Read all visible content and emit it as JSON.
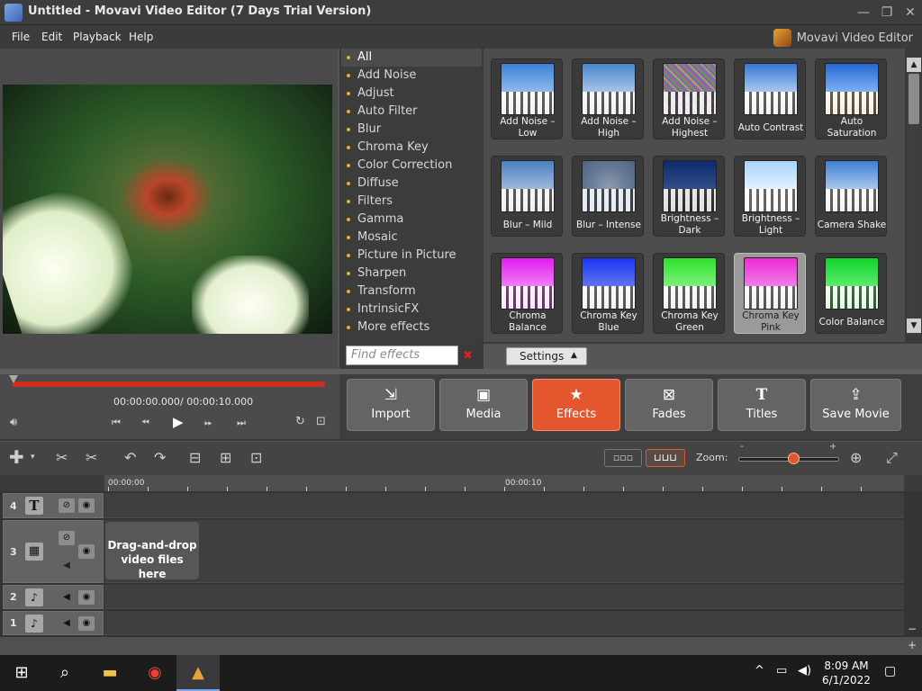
{
  "window": {
    "title": "Untitled - Movavi Video Editor (7 Days Trial Version)",
    "app_icon": "movavi-icon",
    "minimize_glyph": "—",
    "restore_glyph": "❐",
    "close_glyph": "✕",
    "brand": "Movavi Video Editor"
  },
  "menu": [
    "File",
    "Edit",
    "Playback",
    "Help"
  ],
  "effects": {
    "categories": [
      "All",
      "Add Noise",
      "Adjust",
      "Auto Filter",
      "Blur",
      "Chroma Key",
      "Color Correction",
      "Diffuse",
      "Filters",
      "Gamma",
      "Mosaic",
      "Picture in Picture",
      "Sharpen",
      "Transform",
      "IntrinsicFX",
      "More effects"
    ],
    "selected_category": "All",
    "search_placeholder": "Find effects",
    "tiles": [
      {
        "label": "Add Noise – Low",
        "bg": "linear-gradient(180deg,#3e82d6 0%,#8fb8ea 55%,#e9e9e9 56%,#bcbcbc 100%)"
      },
      {
        "label": "Add Noise – High",
        "bg": "linear-gradient(180deg,#4a86cf 0%,#a6c2e6 55%,#dcdcdc 56%,#a8a8a8 100%)"
      },
      {
        "label": "Add Noise – Highest",
        "bg": "repeating-linear-gradient(45deg,#8a5fb0 0 2px,#4fa35a 2px 4px,#c24f9a 4px 6px,#5d77c9 6px 8px,#b8a24a 8px 10px)"
      },
      {
        "label": "Auto Contrast",
        "bg": "linear-gradient(180deg,#3576d1 0%,#a9c8ef 55%,#f3f3f3 56%,#b9b9b9 100%)"
      },
      {
        "label": "Auto Saturation",
        "bg": "linear-gradient(180deg,#2668d4 0%,#7eb0f1 55%,#f2e2a8 56%,#c39a5a 100%)"
      },
      {
        "label": "Blur – Mild",
        "bg": "linear-gradient(180deg,#4a7fc0 0%,#9fb9d9 55%,#cfcfcf 56%,#9d9d9d 100%)"
      },
      {
        "label": "Blur – Intense",
        "bg": "radial-gradient(ellipse at 50% 50%,#8d9aad 0,#687b96 50%,#4d6482 100%)"
      },
      {
        "label": "Brightness – Dark",
        "bg": "linear-gradient(180deg,#0d2a6b 0%,#2f4f87 55%,#6a6a6a 56%,#2b2b2b 100%)"
      },
      {
        "label": "Brightness – Light",
        "bg": "linear-gradient(180deg,#a8d3ff 0%,#e4f1ff 55%,#ffffff 56%,#e8e8e8 100%)"
      },
      {
        "label": "Camera Shake",
        "bg": "linear-gradient(180deg,#3f7ed6 0%,#a8c7ec 55%,#f0f0f0 56%,#bdbdbd 100%)"
      },
      {
        "label": "Chroma Balance",
        "bg": "linear-gradient(180deg,#e21df0 0%,#f07cf5 55%,#f5a9f7 56%,#d55fe0 100%)"
      },
      {
        "label": "Chroma Key Blue",
        "bg": "linear-gradient(180deg,#1d35f0 0%,#5d74f3 55%,#e9e9e9 56%,#b9b9b9 100%)"
      },
      {
        "label": "Chroma Key Green",
        "bg": "linear-gradient(180deg,#2fe02c 0%,#7df07a 55%,#e9e9e9 56%,#b9b9b9 100%)"
      },
      {
        "label": "Chroma Key Pink",
        "bg": "linear-gradient(180deg,#ea2ad6 0%,#f27de6 55%,#eeeeee 56%,#bdbdbd 100%)"
      },
      {
        "label": "Color Balance",
        "bg": "linear-gradient(180deg,#0fd42a 0%,#5cea6d 55%,#a6f6ad 56%,#36c24a 100%)"
      }
    ],
    "selected_tile": "Chroma Key Pink",
    "settings_label": "Settings"
  },
  "player": {
    "current_time": "00:00:00.000",
    "total_time": "/ 00:00:10.000"
  },
  "nav": [
    {
      "label": "Import",
      "icon": "import-icon",
      "glyph": "⇲"
    },
    {
      "label": "Media",
      "icon": "media-icon",
      "glyph": "▣"
    },
    {
      "label": "Effects",
      "icon": "effects-icon",
      "glyph": "★"
    },
    {
      "label": "Fades",
      "icon": "fades-icon",
      "glyph": "⊠"
    },
    {
      "label": "Titles",
      "icon": "titles-icon",
      "glyph": "T"
    },
    {
      "label": "Save Movie",
      "icon": "save-movie-icon",
      "glyph": "⇪"
    }
  ],
  "nav_selected": "Effects",
  "timeline": {
    "zoom_label": "Zoom:",
    "zoom_minus": "-",
    "zoom_plus": "+",
    "zoom_level": 0.55,
    "ruler": [
      "00:00:00",
      "00:00:10"
    ],
    "tracks": [
      {
        "number": "4",
        "type": "title"
      },
      {
        "number": "3",
        "type": "video"
      },
      {
        "number": "2",
        "type": "audio"
      },
      {
        "number": "1",
        "type": "audio"
      }
    ],
    "drop_hint": "Drag-and-drop video files here"
  },
  "taskbar": {
    "time": "8:09 AM",
    "date": "6/1/2022"
  },
  "colors": {
    "accent": "#e4572e",
    "progress": "#cc2f1d",
    "category_bullet": "#e6b420"
  }
}
